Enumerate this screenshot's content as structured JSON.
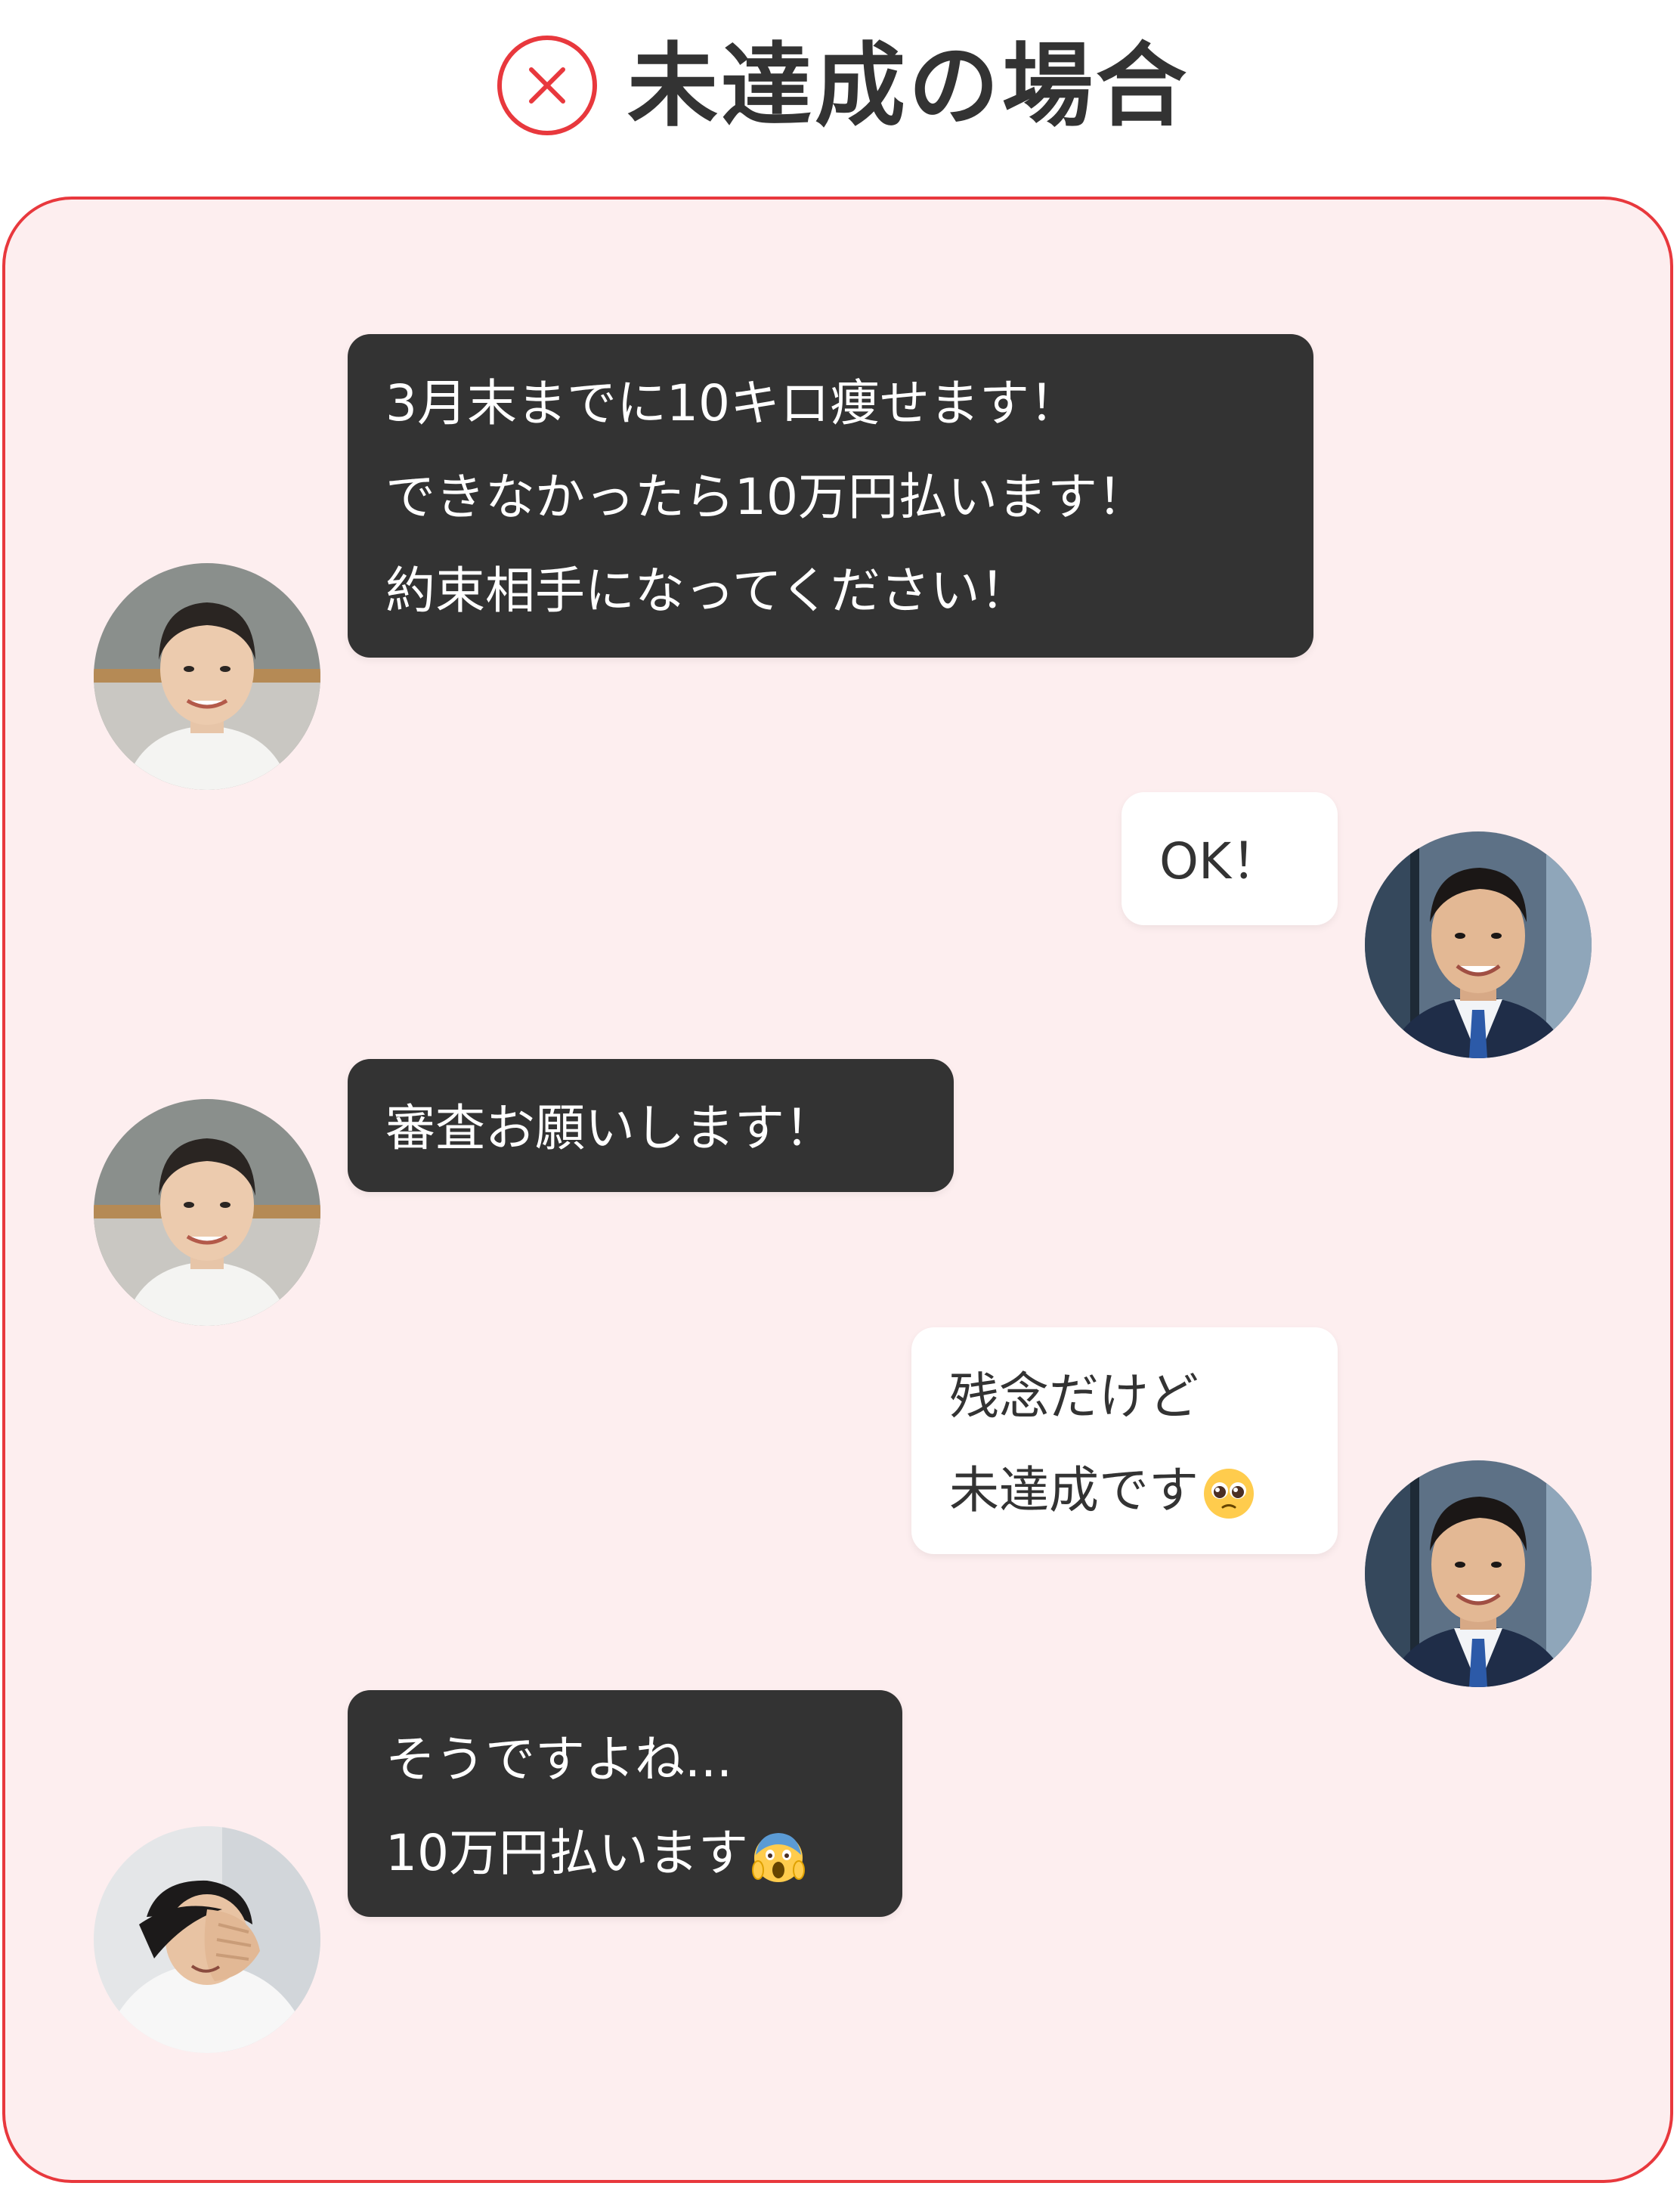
{
  "header": {
    "title": "未達成の場合",
    "icon": "x-circle-icon",
    "accent_color": "#e8383d"
  },
  "panel": {
    "background_color": "#fdeeef",
    "border_color": "#e8383d"
  },
  "messages": [
    {
      "sender": "left",
      "avatar": "smiling-man-white-shirt",
      "lines": [
        "3月末までに10キロ痩せます！",
        "できなかったら10万円払います！",
        "約束相手になってください！"
      ]
    },
    {
      "sender": "right",
      "avatar": "businessman-suit",
      "lines": [
        "OK！"
      ]
    },
    {
      "sender": "left",
      "avatar": "smiling-man-white-shirt",
      "lines": [
        "審査お願いします！"
      ]
    },
    {
      "sender": "right",
      "avatar": "businessman-suit",
      "lines": [
        "残念だけど",
        "未達成です"
      ],
      "emoji": "pleading-face-emoji"
    },
    {
      "sender": "left",
      "avatar": "man-covering-face",
      "lines": [
        "そうですよね...",
        "10万円払います"
      ],
      "emoji": "screaming-face-emoji"
    }
  ]
}
